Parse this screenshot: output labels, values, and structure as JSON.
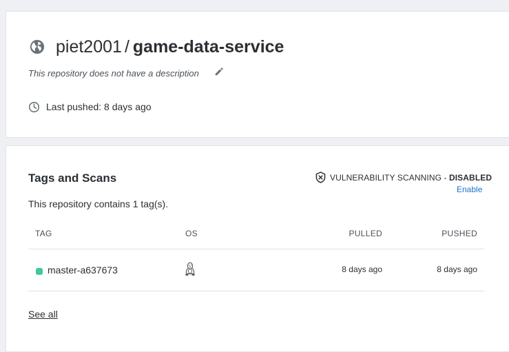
{
  "repo": {
    "owner": "piet2001",
    "separator": "/",
    "name": "game-data-service",
    "description": "This repository does not have a description",
    "last_pushed": "Last pushed: 8 days ago"
  },
  "tags_section": {
    "title": "Tags and Scans",
    "vuln_label": "VULNERABILITY SCANNING - ",
    "vuln_status": "DISABLED",
    "enable_label": "Enable",
    "tag_count_text": "This repository contains 1 tag(s).",
    "columns": {
      "tag": "TAG",
      "os": "OS",
      "pulled": "PULLED",
      "pushed": "PUSHED"
    },
    "rows": [
      {
        "tag": "master-a637673",
        "os_icon": "linux-icon",
        "pulled": "8 days ago",
        "pushed": "8 days ago",
        "status_color": "#3ec7a0"
      }
    ],
    "see_all_label": "See all"
  },
  "colors": {
    "link": "#1a73c9",
    "icon_gray": "#6b7378",
    "status_green": "#3ec7a0"
  }
}
